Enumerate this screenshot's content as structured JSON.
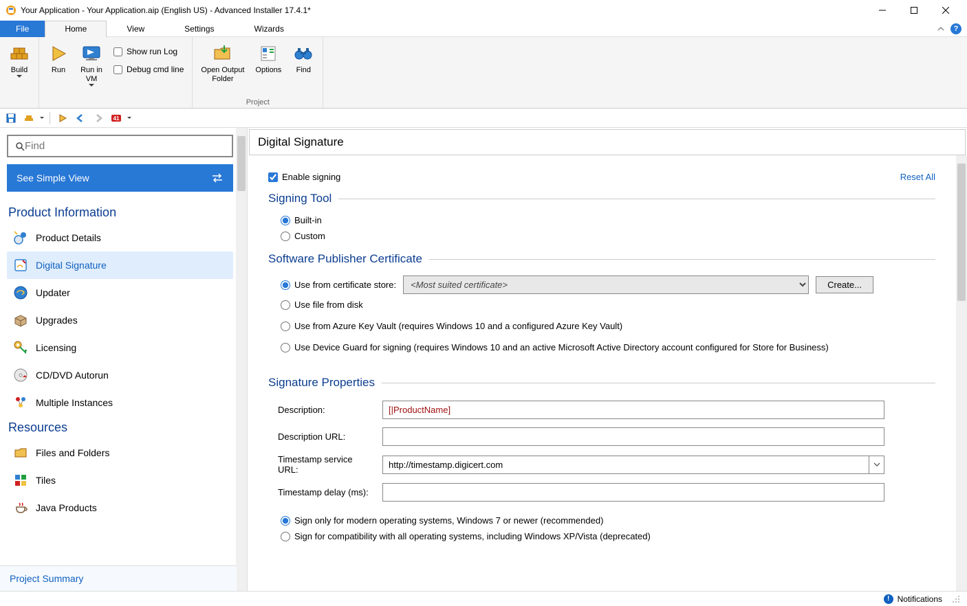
{
  "window": {
    "title": "Your Application - Your Application.aip (English US) - Advanced Installer 17.4.1*"
  },
  "ribbon_tabs": {
    "file": "File",
    "home": "Home",
    "view": "View",
    "settings": "Settings",
    "wizards": "Wizards"
  },
  "ribbon": {
    "build": "Build",
    "run": "Run",
    "run_in_vm": "Run in\nVM",
    "show_run_log": "Show run Log",
    "debug_cmd": "Debug cmd line",
    "open_output": "Open Output\nFolder",
    "options": "Options",
    "find": "Find",
    "group_project": "Project"
  },
  "sidebar": {
    "search_placeholder": "Find",
    "simple_view": "See Simple View",
    "section_product": "Product Information",
    "items_product": [
      "Product Details",
      "Digital Signature",
      "Updater",
      "Upgrades",
      "Licensing",
      "CD/DVD Autorun",
      "Multiple Instances"
    ],
    "section_resources": "Resources",
    "items_resources": [
      "Files and Folders",
      "Tiles",
      "Java Products"
    ],
    "project_summary": "Project Summary"
  },
  "content": {
    "title": "Digital Signature",
    "enable_signing": "Enable signing",
    "reset_all": "Reset All",
    "section_signing_tool": "Signing Tool",
    "radio_builtin": "Built-in",
    "radio_custom": "Custom",
    "section_cert": "Software Publisher Certificate",
    "radio_cert_store": "Use from certificate store:",
    "cert_dropdown": "<Most suited certificate>",
    "create_btn": "Create...",
    "radio_file_disk": "Use file from disk",
    "radio_azure": "Use from Azure Key Vault (requires Windows 10 and a configured Azure Key Vault)",
    "radio_device_guard": "Use Device Guard for signing (requires Windows 10 and an active Microsoft Active Directory account configured for Store for Business)",
    "section_sig_props": "Signature Properties",
    "label_description": "Description:",
    "value_description": "[|ProductName]",
    "label_desc_url": "Description URL:",
    "value_desc_url": "",
    "label_ts_url": "Timestamp service URL:",
    "value_ts_url": "http://timestamp.digicert.com",
    "label_ts_delay": "Timestamp delay (ms):",
    "value_ts_delay": "",
    "radio_modern": "Sign only for modern operating systems, Windows 7 or newer (recommended)",
    "radio_compat": "Sign for compatibility with all operating systems, including Windows XP/Vista (deprecated)"
  },
  "statusbar": {
    "notifications": "Notifications"
  }
}
